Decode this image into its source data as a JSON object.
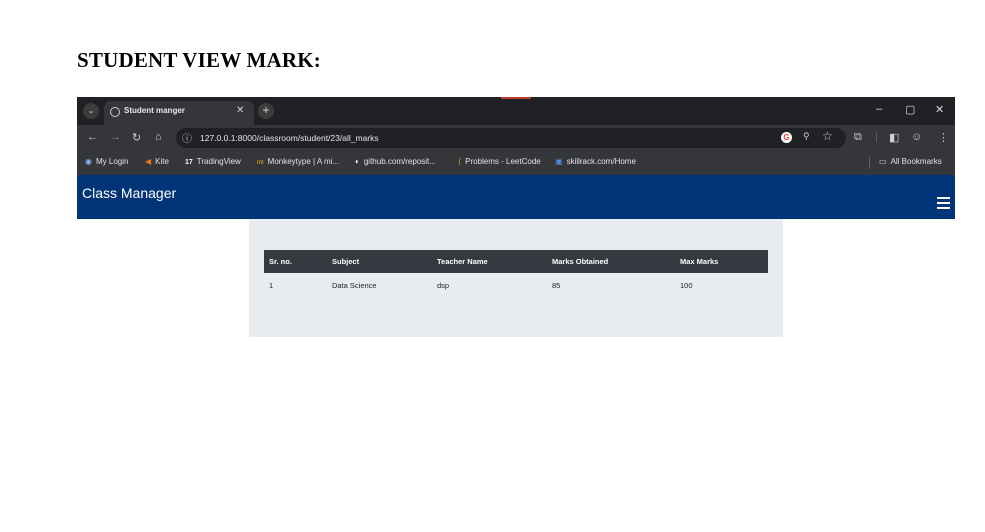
{
  "document": {
    "title": "STUDENT VIEW MARK:"
  },
  "browser": {
    "tab_title": "Student manger",
    "new_tab": "+",
    "tab_close": "✕",
    "tab_menu": "⌄",
    "window": {
      "minimize": "–",
      "restore": "▢",
      "close": "✕"
    },
    "url": "127.0.0.1:8000/classroom/student/23/all_marks",
    "google_badge": "G",
    "bookmarks": [
      {
        "label": "My Login",
        "icon": "login-icon",
        "glyph": "◉",
        "color": "#8ab4f8"
      },
      {
        "label": "Kite",
        "icon": "kite-icon",
        "glyph": "◀",
        "color": "#e8711c"
      },
      {
        "label": "TradingView",
        "icon": "tradingview-icon",
        "glyph": "17",
        "color": "#ffffff"
      },
      {
        "label": "Monkeytype | A mi...",
        "icon": "monkeytype-icon",
        "glyph": "mt",
        "color": "#e2b714"
      },
      {
        "label": "github.com/reposit...",
        "icon": "github-icon",
        "glyph": "◐",
        "color": "#ffffff"
      },
      {
        "label": "Problems - LeetCode",
        "icon": "leetcode-icon",
        "glyph": "⟨",
        "color": "#ffa116"
      },
      {
        "label": "skillrack.com/Home",
        "icon": "skillrack-icon",
        "glyph": "▣",
        "color": "#4a90e2"
      }
    ],
    "all_bookmarks": "All Bookmarks"
  },
  "app": {
    "brand": "Class Manager"
  },
  "table": {
    "headers": [
      "Sr. no.",
      "Subject",
      "Teacher Name",
      "Marks Obtained",
      "Max Marks"
    ],
    "rows": [
      [
        "1",
        "Data Science",
        "dsp",
        "85",
        "100"
      ]
    ]
  },
  "colors": {
    "navbar": "#003478",
    "table_header": "#343a40",
    "panel": "#e9ecef",
    "browser_dark": "#202124",
    "browser_mid": "#35363a"
  }
}
